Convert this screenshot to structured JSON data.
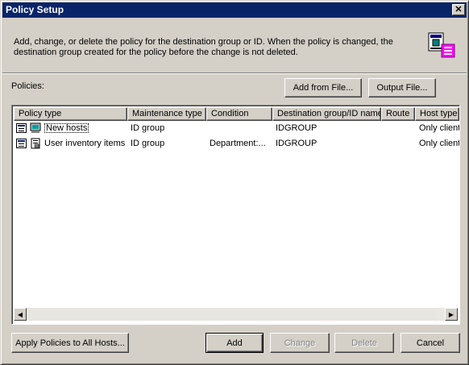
{
  "window": {
    "title": "Policy Setup",
    "close_symbol": "✕"
  },
  "description": "Add, change, or delete the policy for the destination group or ID. When the policy is changed, the destination group created for the policy before the change is not deleted.",
  "policies_label": "Policies:",
  "buttons": {
    "add_from_file": "Add from File...",
    "output_file": "Output File...",
    "apply_all": "Apply Policies to All Hosts...",
    "add": "Add",
    "change": "Change",
    "delete": "Delete",
    "cancel": "Cancel"
  },
  "table": {
    "columns": [
      "Policy type",
      "Maintenance type",
      "Condition",
      "Destination group/ID name",
      "Route",
      "Host type"
    ],
    "rows": [
      {
        "policy_type": "New hosts",
        "maintenance_type": "ID group",
        "condition": "",
        "destination": "IDGROUP",
        "route": "",
        "host_type": "Only client"
      },
      {
        "policy_type": "User inventory items",
        "maintenance_type": "ID group",
        "condition": "Department:...",
        "destination": "IDGROUP",
        "route": "",
        "host_type": "Only client"
      }
    ]
  },
  "icons": {
    "title_close": "close-icon",
    "header_graphic": "policy-setup-icon",
    "row_list": "list-icon",
    "row_new_hosts": "computer-icon",
    "row_inventory": "inventory-icon",
    "scroll_left": "arrow-left-icon",
    "scroll_right": "arrow-right-icon"
  },
  "colors": {
    "title_bar": "#0a246a",
    "dialog_bg": "#d4d0c8",
    "list_bg": "#ffffff"
  }
}
